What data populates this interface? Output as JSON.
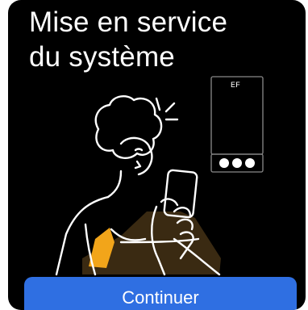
{
  "screen": {
    "title": "Mise en service\ndu système",
    "device_brand_mark": "EF"
  },
  "actions": {
    "continue_label": "Continuer"
  },
  "colors": {
    "background": "#000000",
    "accent": "#2f6fe2",
    "skin": "#3a2a12",
    "shirt": "#f2a51a",
    "line": "#ffffff"
  },
  "icons": {
    "illustration": "person-holding-phone-illustration",
    "device": "wall-mounted-battery-icon"
  }
}
